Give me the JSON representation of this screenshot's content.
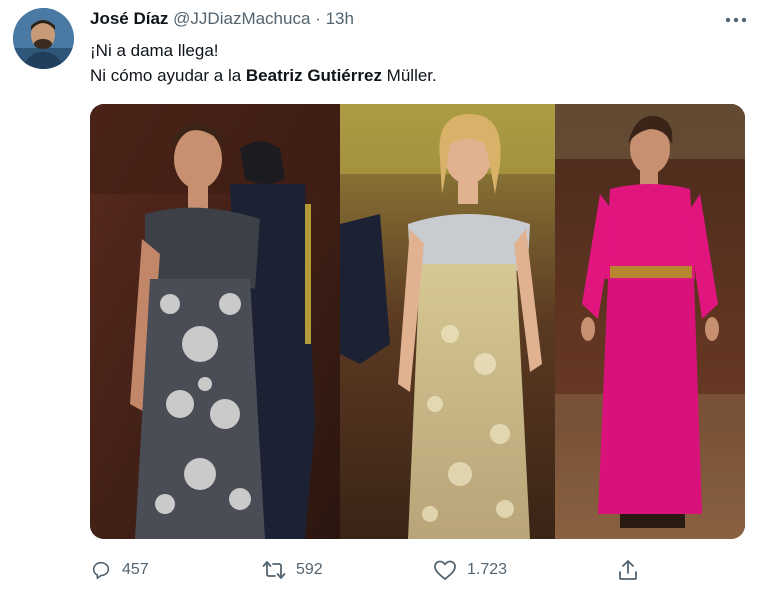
{
  "tweet": {
    "author_name": "José Díaz",
    "handle": "@JJDiazMachuca",
    "separator": "·",
    "time": "13h",
    "line1": "¡Ni a dama llega!",
    "line2_prefix": "Ni cómo ayudar a la ",
    "line2_bold": "Beatriz Gutiérrez",
    "line2_suffix": " Müller.",
    "reply_count": "457",
    "retweet_count": "592",
    "like_count": "1.723"
  },
  "icons": {
    "more": "more-dots-icon",
    "reply": "reply-bubble-icon",
    "retweet": "retweet-icon",
    "like": "heart-icon",
    "share": "share-upload-icon"
  },
  "colors": {
    "text": "#0f1419",
    "secondary": "#536471",
    "pink_dress": "#e0157e",
    "gold_dress": "#c8b98a",
    "dark_dress": "#3a3d44"
  }
}
